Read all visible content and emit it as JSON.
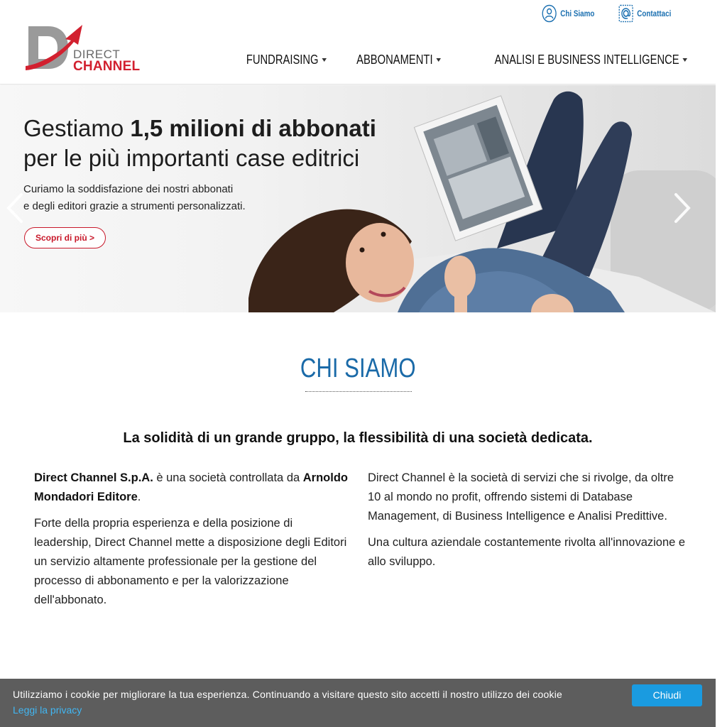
{
  "brand": {
    "logo_line_1": "DIRECT",
    "logo_line_2": "CHANNEL",
    "color_red": "#d2202f",
    "color_grey": "#9a9a9a",
    "color_blue": "#1a6aa8"
  },
  "topbar": {
    "chi_siamo": "Chi Siamo",
    "contattaci": "Contattaci"
  },
  "nav": {
    "items": [
      {
        "label": "FUNDRAISING"
      },
      {
        "label": "ABBONAMENTI"
      },
      {
        "label": "ANALISI E BUSINESS INTELLIGENCE"
      }
    ]
  },
  "hero": {
    "title_pre": "Gestiamo ",
    "title_bold": "1,5 milioni di abbonati",
    "title_line_2": "per le più importanti case editrici",
    "sub_line_1": "Curiamo la soddisfazione dei nostri abbonati",
    "sub_line_2": "e degli editori grazie a strumenti personalizzati.",
    "cta": "Scopri di più >"
  },
  "about": {
    "title": "CHI SIAMO",
    "lead": "La solidità di un grande gruppo, la flessibilità di una società dedicata.",
    "left": {
      "p1_bold_1": "Direct Channel S.p.A.",
      "p1_text_1": " è una società controllata da ",
      "p1_bold_2": "Arnoldo Mondadori Editore",
      "p1_text_2": ".",
      "p2": "Forte della propria esperienza e della posizione di leadership, Direct Channel mette a disposizione degli Editori un servizio altamente professionale per la gestione del processo di abbonamento e per la valorizzazione dell'abbonato."
    },
    "right": {
      "p1": "Direct Channel è la società di servizi che si rivolge, da oltre 10 al mondo no profit, offrendo sistemi di Database Management, di Business Intelligence e Analisi Predittive.",
      "p2": "Una cultura aziendale costantemente rivolta all'innovazione e allo sviluppo."
    }
  },
  "cookie": {
    "text": "Utilizziamo i cookie per migliorare la tua esperienza. Continuando a visitare questo sito accetti il nostro utilizzo dei cookie",
    "privacy_link": "Leggi la privacy",
    "accept": "Chiudi"
  }
}
